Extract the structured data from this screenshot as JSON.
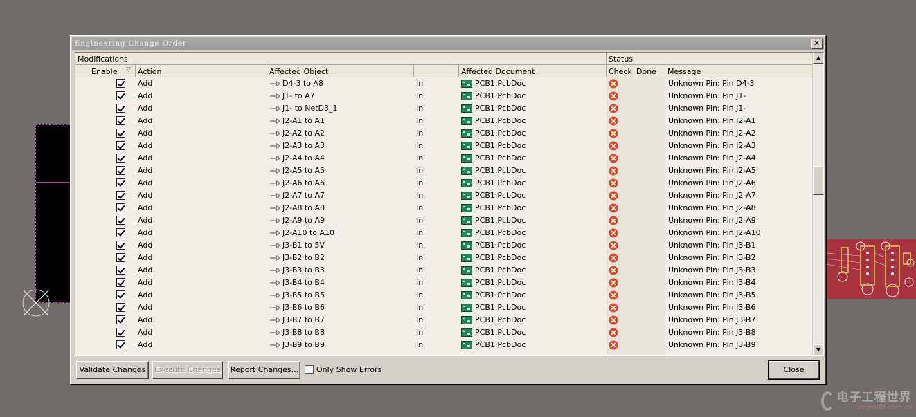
{
  "dialog": {
    "title": "Engineering Change Order",
    "close_glyph": "✕"
  },
  "groups": {
    "modifications": "Modifications",
    "status": "Status"
  },
  "columns": {
    "enable": "Enable",
    "action": "Action",
    "affected_object": "Affected Object",
    "affected_document": "Affected Document",
    "check": "Check",
    "done": "Done",
    "message": "Message"
  },
  "rows": [
    {
      "action": "Add",
      "object": "D4-3 to A8",
      "dir": "In",
      "document": "PCB1.PcbDoc",
      "message": "Unknown Pin: Pin D4-3"
    },
    {
      "action": "Add",
      "object": "J1- to A7",
      "dir": "In",
      "document": "PCB1.PcbDoc",
      "message": "Unknown Pin: Pin J1-"
    },
    {
      "action": "Add",
      "object": "J1- to NetD3_1",
      "dir": "In",
      "document": "PCB1.PcbDoc",
      "message": "Unknown Pin: Pin J1-"
    },
    {
      "action": "Add",
      "object": "J2-A1 to A1",
      "dir": "In",
      "document": "PCB1.PcbDoc",
      "message": "Unknown Pin: Pin J2-A1"
    },
    {
      "action": "Add",
      "object": "J2-A2 to A2",
      "dir": "In",
      "document": "PCB1.PcbDoc",
      "message": "Unknown Pin: Pin J2-A2"
    },
    {
      "action": "Add",
      "object": "J2-A3 to A3",
      "dir": "In",
      "document": "PCB1.PcbDoc",
      "message": "Unknown Pin: Pin J2-A3"
    },
    {
      "action": "Add",
      "object": "J2-A4 to A4",
      "dir": "In",
      "document": "PCB1.PcbDoc",
      "message": "Unknown Pin: Pin J2-A4"
    },
    {
      "action": "Add",
      "object": "J2-A5 to A5",
      "dir": "In",
      "document": "PCB1.PcbDoc",
      "message": "Unknown Pin: Pin J2-A5"
    },
    {
      "action": "Add",
      "object": "J2-A6 to A6",
      "dir": "In",
      "document": "PCB1.PcbDoc",
      "message": "Unknown Pin: Pin J2-A6"
    },
    {
      "action": "Add",
      "object": "J2-A7 to A7",
      "dir": "In",
      "document": "PCB1.PcbDoc",
      "message": "Unknown Pin: Pin J2-A7"
    },
    {
      "action": "Add",
      "object": "J2-A8 to A8",
      "dir": "In",
      "document": "PCB1.PcbDoc",
      "message": "Unknown Pin: Pin J2-A8"
    },
    {
      "action": "Add",
      "object": "J2-A9 to A9",
      "dir": "In",
      "document": "PCB1.PcbDoc",
      "message": "Unknown Pin: Pin J2-A9"
    },
    {
      "action": "Add",
      "object": "J2-A10 to A10",
      "dir": "In",
      "document": "PCB1.PcbDoc",
      "message": "Unknown Pin: Pin J2-A10"
    },
    {
      "action": "Add",
      "object": "J3-B1 to 5V",
      "dir": "In",
      "document": "PCB1.PcbDoc",
      "message": "Unknown Pin: Pin J3-B1"
    },
    {
      "action": "Add",
      "object": "J3-B2 to B2",
      "dir": "In",
      "document": "PCB1.PcbDoc",
      "message": "Unknown Pin: Pin J3-B2"
    },
    {
      "action": "Add",
      "object": "J3-B3 to B3",
      "dir": "In",
      "document": "PCB1.PcbDoc",
      "message": "Unknown Pin: Pin J3-B3"
    },
    {
      "action": "Add",
      "object": "J3-B4 to B4",
      "dir": "In",
      "document": "PCB1.PcbDoc",
      "message": "Unknown Pin: Pin J3-B4"
    },
    {
      "action": "Add",
      "object": "J3-B5 to B5",
      "dir": "In",
      "document": "PCB1.PcbDoc",
      "message": "Unknown Pin: Pin J3-B5"
    },
    {
      "action": "Add",
      "object": "J3-B6 to B6",
      "dir": "In",
      "document": "PCB1.PcbDoc",
      "message": "Unknown Pin: Pin J3-B6"
    },
    {
      "action": "Add",
      "object": "J3-B7 to B7",
      "dir": "In",
      "document": "PCB1.PcbDoc",
      "message": "Unknown Pin: Pin J3-B7"
    },
    {
      "action": "Add",
      "object": "J3-B8 to B8",
      "dir": "In",
      "document": "PCB1.PcbDoc",
      "message": "Unknown Pin: Pin J3-B8"
    },
    {
      "action": "Add",
      "object": "J3-B9 to B9",
      "dir": "In",
      "document": "PCB1.PcbDoc",
      "message": "Unknown Pin: Pin J3-B9"
    }
  ],
  "buttons": {
    "validate": "Validate Changes",
    "execute": "Execute Changes",
    "report": "Report Changes...",
    "close": "Close"
  },
  "only_show_errors": "Only Show Errors",
  "watermark": {
    "cn": "电子工程世界",
    "en": "eeworld.com.cn"
  },
  "colors": {
    "error": "#e2441f",
    "pcb_board": "#a8333f",
    "doc_icon": "#1f8a55"
  }
}
